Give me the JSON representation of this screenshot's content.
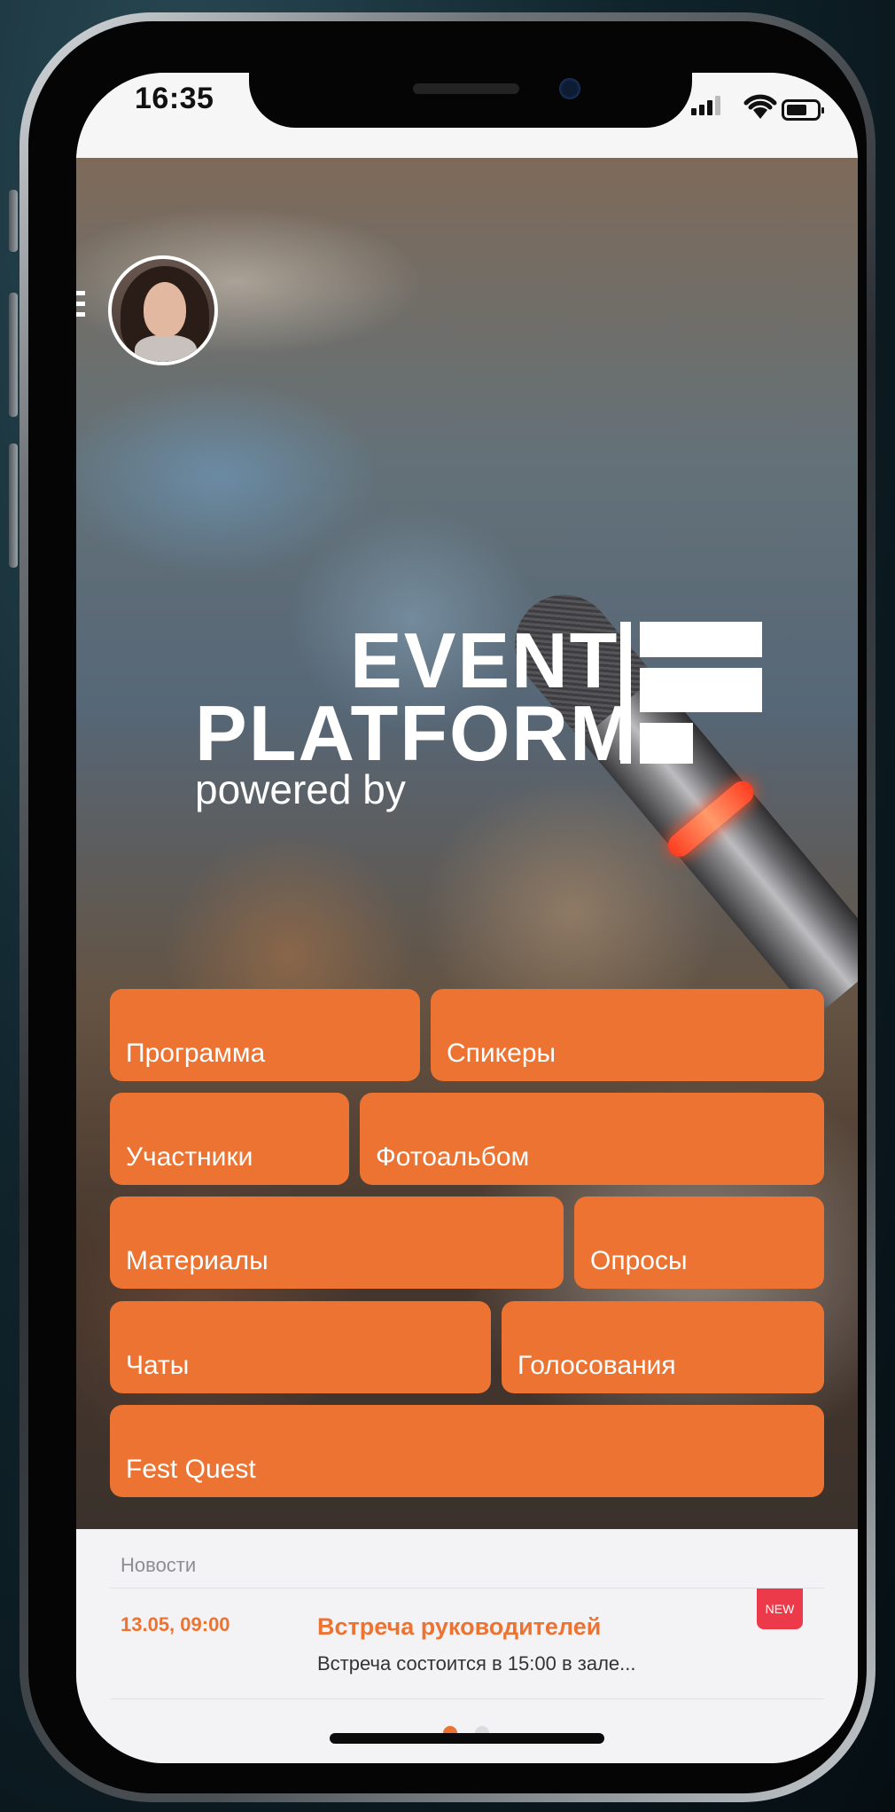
{
  "status_bar": {
    "time": "16:35"
  },
  "hero": {
    "logo": {
      "line1": "EVENT",
      "line2": "PLATFORM",
      "line3": "powered by"
    }
  },
  "tiles": [
    {
      "label": "Программа"
    },
    {
      "label": "Спикеры"
    },
    {
      "label": "Участники"
    },
    {
      "label": "Фотоальбом"
    },
    {
      "label": "Материалы"
    },
    {
      "label": "Опросы"
    },
    {
      "label": "Чаты"
    },
    {
      "label": "Голосования"
    },
    {
      "label": "Fest Quest"
    }
  ],
  "news": {
    "section_title": "Новости",
    "items": [
      {
        "date": "13.05, 09:00",
        "headline": "Встреча руководителей",
        "text": "Встреча состоится в 15:00 в зале...",
        "badge": "NEW"
      }
    ],
    "pager": {
      "current": 1,
      "total": 2
    }
  },
  "colors": {
    "accent": "#ec7331",
    "badge": "#ec3a4a",
    "background": "#f3f3f6"
  }
}
